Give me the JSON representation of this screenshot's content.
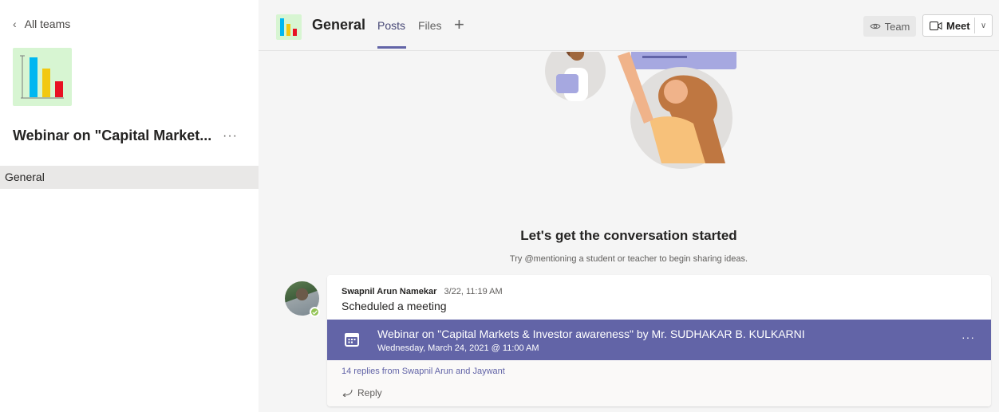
{
  "sidebar": {
    "back_label": "All teams",
    "team_name": "Webinar on \"Capital Market...",
    "more_glyph": "···",
    "channels": [
      {
        "label": "General",
        "selected": true
      }
    ]
  },
  "header": {
    "channel_name": "General",
    "tabs": [
      {
        "label": "Posts",
        "active": true
      },
      {
        "label": "Files",
        "active": false
      }
    ],
    "add_tab_glyph": "+",
    "team_button": "Team",
    "meet_button": "Meet"
  },
  "empty_state": {
    "title": "Let's get the conversation started",
    "subtitle": "Try @mentioning a student or teacher to begin sharing ideas."
  },
  "post": {
    "author": "Swapnil Arun Namekar",
    "timestamp": "3/22, 11:19 AM",
    "message": "Scheduled a meeting",
    "meeting_title": "Webinar on \"Capital Markets & Investor awareness\" by Mr. SUDHAKAR B. KULKARNI",
    "meeting_datetime": "Wednesday, March 24, 2021 @ 11:00 AM",
    "more_glyph": "···",
    "replies_summary": "14 replies from Swapnil Arun and Jaywant",
    "reply_label": "Reply"
  },
  "colors": {
    "brand": "#6264a7",
    "presence_available": "#92c353",
    "chart_bars": [
      "#00b7f1",
      "#f2c811",
      "#e81123"
    ]
  }
}
